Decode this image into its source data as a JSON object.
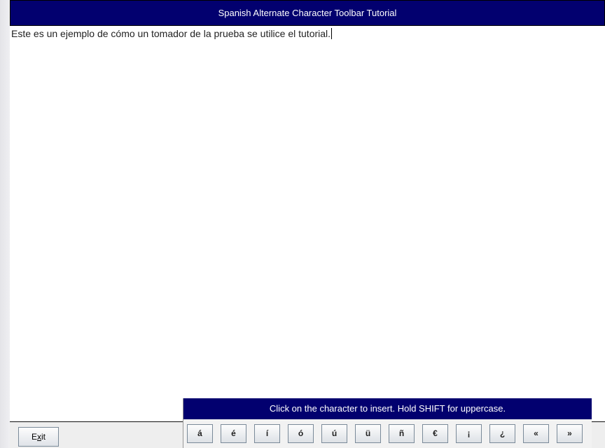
{
  "window": {
    "title": "Spanish Alternate Character Toolbar Tutorial"
  },
  "editor": {
    "text": "Este es un ejemplo de cómo un tomador de la prueba se utilice el tutorial."
  },
  "exit_button": {
    "label_prefix": "E",
    "label_mnemonic": "x",
    "label_suffix": "it"
  },
  "toolbar": {
    "hint": "Click on the character to insert.  Hold SHIFT for uppercase.",
    "characters": [
      "á",
      "é",
      "í",
      "ó",
      "ú",
      "ü",
      "ñ",
      "€",
      "¡",
      "¿",
      "«",
      "»"
    ]
  },
  "colors": {
    "title_bar": "#02006f",
    "toolbar_hint_bar": "#02006f"
  }
}
